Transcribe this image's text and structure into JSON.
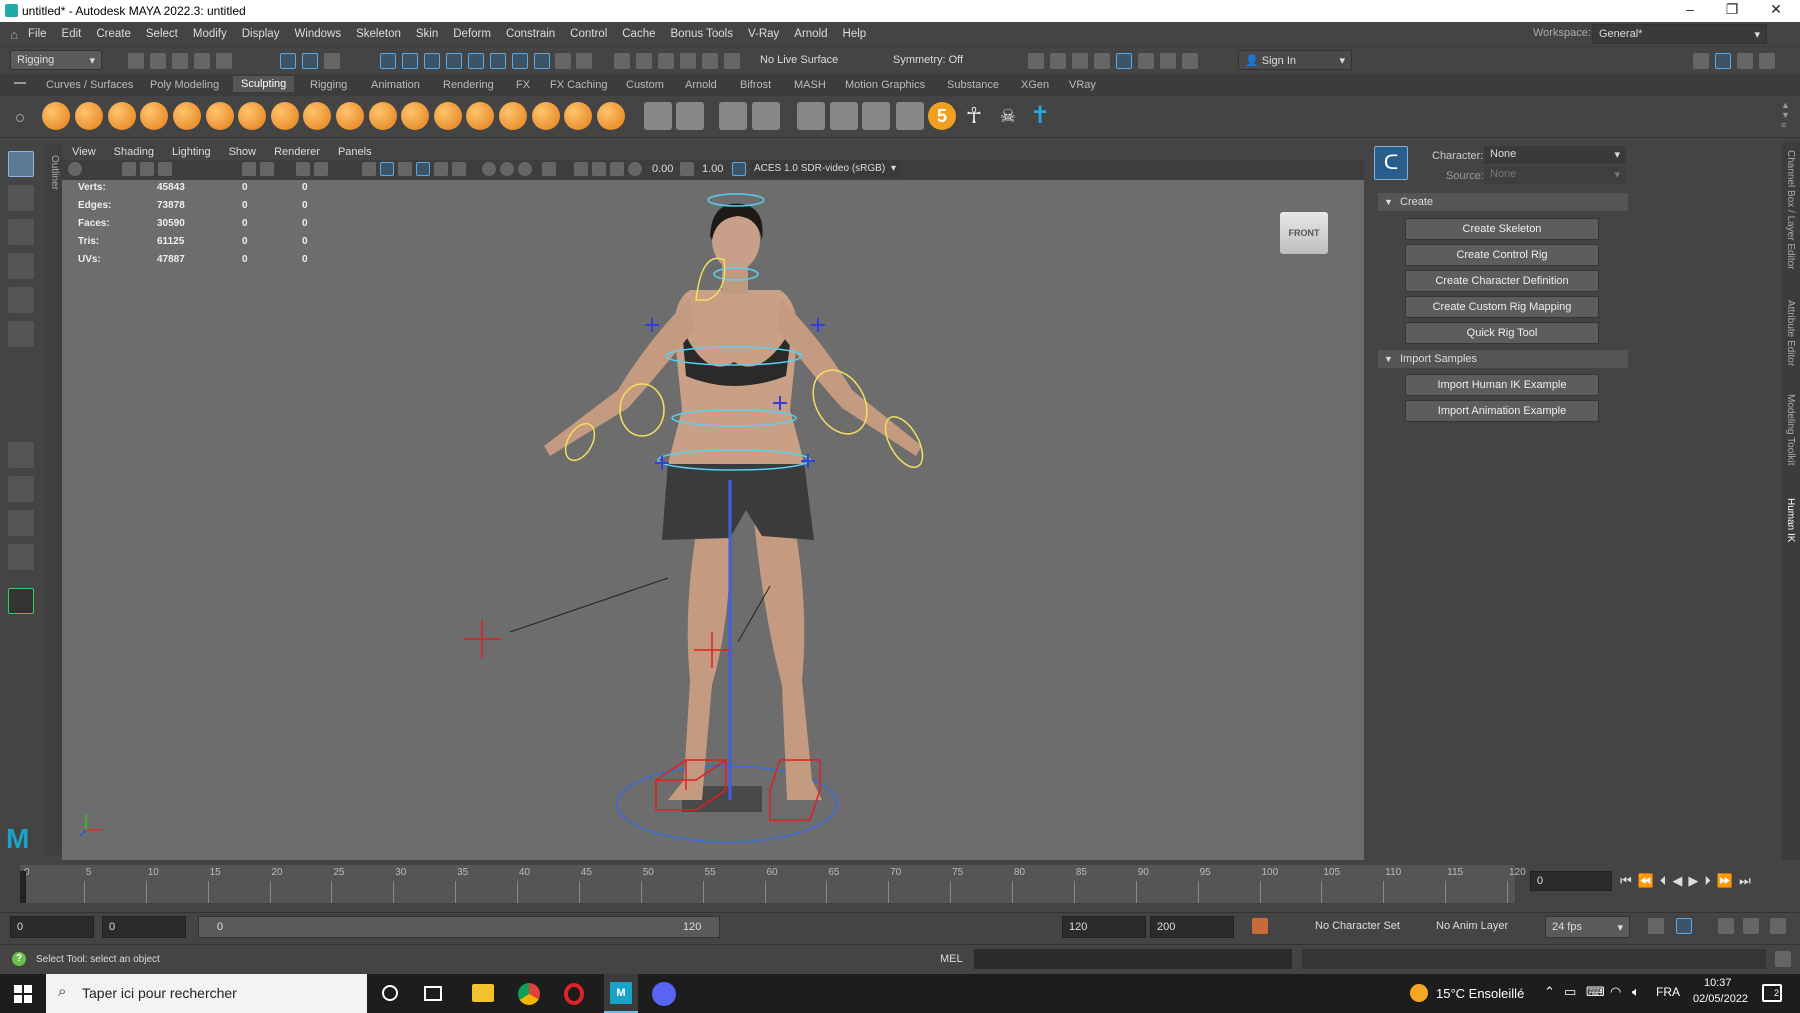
{
  "window": {
    "title": "untitled* - Autodesk MAYA 2022.3: untitled"
  },
  "menu": [
    "File",
    "Edit",
    "Create",
    "Select",
    "Modify",
    "Display",
    "Windows",
    "Skeleton",
    "Skin",
    "Deform",
    "Constrain",
    "Control",
    "Cache",
    "Bonus Tools",
    "V-Ray",
    "Arnold",
    "Help"
  ],
  "workspace": {
    "label": "Workspace:",
    "value": "General*"
  },
  "status": {
    "mode": "Rigging",
    "live_surface": "No Live Surface",
    "symmetry": "Symmetry: Off",
    "sign_in": "Sign In"
  },
  "shelf_tabs": [
    "Curves / Surfaces",
    "Poly Modeling",
    "Sculpting",
    "Rigging",
    "Animation",
    "Rendering",
    "FX",
    "FX Caching",
    "Custom",
    "Arnold",
    "Bifrost",
    "MASH",
    "Motion Graphics",
    "Substance",
    "XGen",
    "VRay"
  ],
  "shelf_active": "Sculpting",
  "shelf_badge": "5",
  "toolbox_tab": "Outliner",
  "panel_menu": [
    "View",
    "Shading",
    "Lighting",
    "Show",
    "Renderer",
    "Panels"
  ],
  "panel_toolbar": {
    "exposure": "0.00",
    "gamma": "1.00",
    "colorspace": "ACES 1.0 SDR-video (sRGB)"
  },
  "hud": [
    {
      "label": "Verts:",
      "v1": "45843",
      "v2": "0",
      "v3": "0"
    },
    {
      "label": "Edges:",
      "v1": "73878",
      "v2": "0",
      "v3": "0"
    },
    {
      "label": "Faces:",
      "v1": "30590",
      "v2": "0",
      "v3": "0"
    },
    {
      "label": "Tris:",
      "v1": "61125",
      "v2": "0",
      "v3": "0"
    },
    {
      "label": "UVs:",
      "v1": "47887",
      "v2": "0",
      "v3": "0"
    }
  ],
  "viewcube": "FRONT",
  "humanik": {
    "character_label": "Character:",
    "character_value": "None",
    "source_label": "Source:",
    "source_value": "None",
    "create_section": "Create",
    "create_buttons": [
      "Create Skeleton",
      "Create Control Rig",
      "Create Character Definition",
      "Create Custom Rig Mapping",
      "Quick Rig Tool"
    ],
    "import_section": "Import Samples",
    "import_buttons": [
      "Import Human IK Example",
      "Import Animation Example"
    ]
  },
  "right_tabs": [
    "Channel Box / Layer Editor",
    "Attribute Editor",
    "Modeling Toolkit",
    "Human IK"
  ],
  "timeline": {
    "ticks": [
      "0",
      "5",
      "10",
      "15",
      "20",
      "25",
      "30",
      "35",
      "40",
      "45",
      "50",
      "55",
      "60",
      "65",
      "70",
      "75",
      "80",
      "85",
      "90",
      "95",
      "100",
      "105",
      "110",
      "115",
      "120"
    ],
    "current_frame": "0",
    "current_marker": "0"
  },
  "range": {
    "start": "0",
    "anim_start": "0",
    "slider_left": "0",
    "slider_right": "120",
    "end": "120",
    "anim_end": "200",
    "char_set": "No Character Set",
    "anim_layer": "No Anim Layer",
    "fps": "24 fps"
  },
  "help": {
    "text": "Select Tool: select an object",
    "mel": "MEL"
  },
  "taskbar": {
    "search": "Taper ici pour rechercher",
    "weather": "15°C Ensoleillé",
    "lang": "FRA",
    "time": "10:37",
    "date": "02/05/2022",
    "notif": "2"
  }
}
